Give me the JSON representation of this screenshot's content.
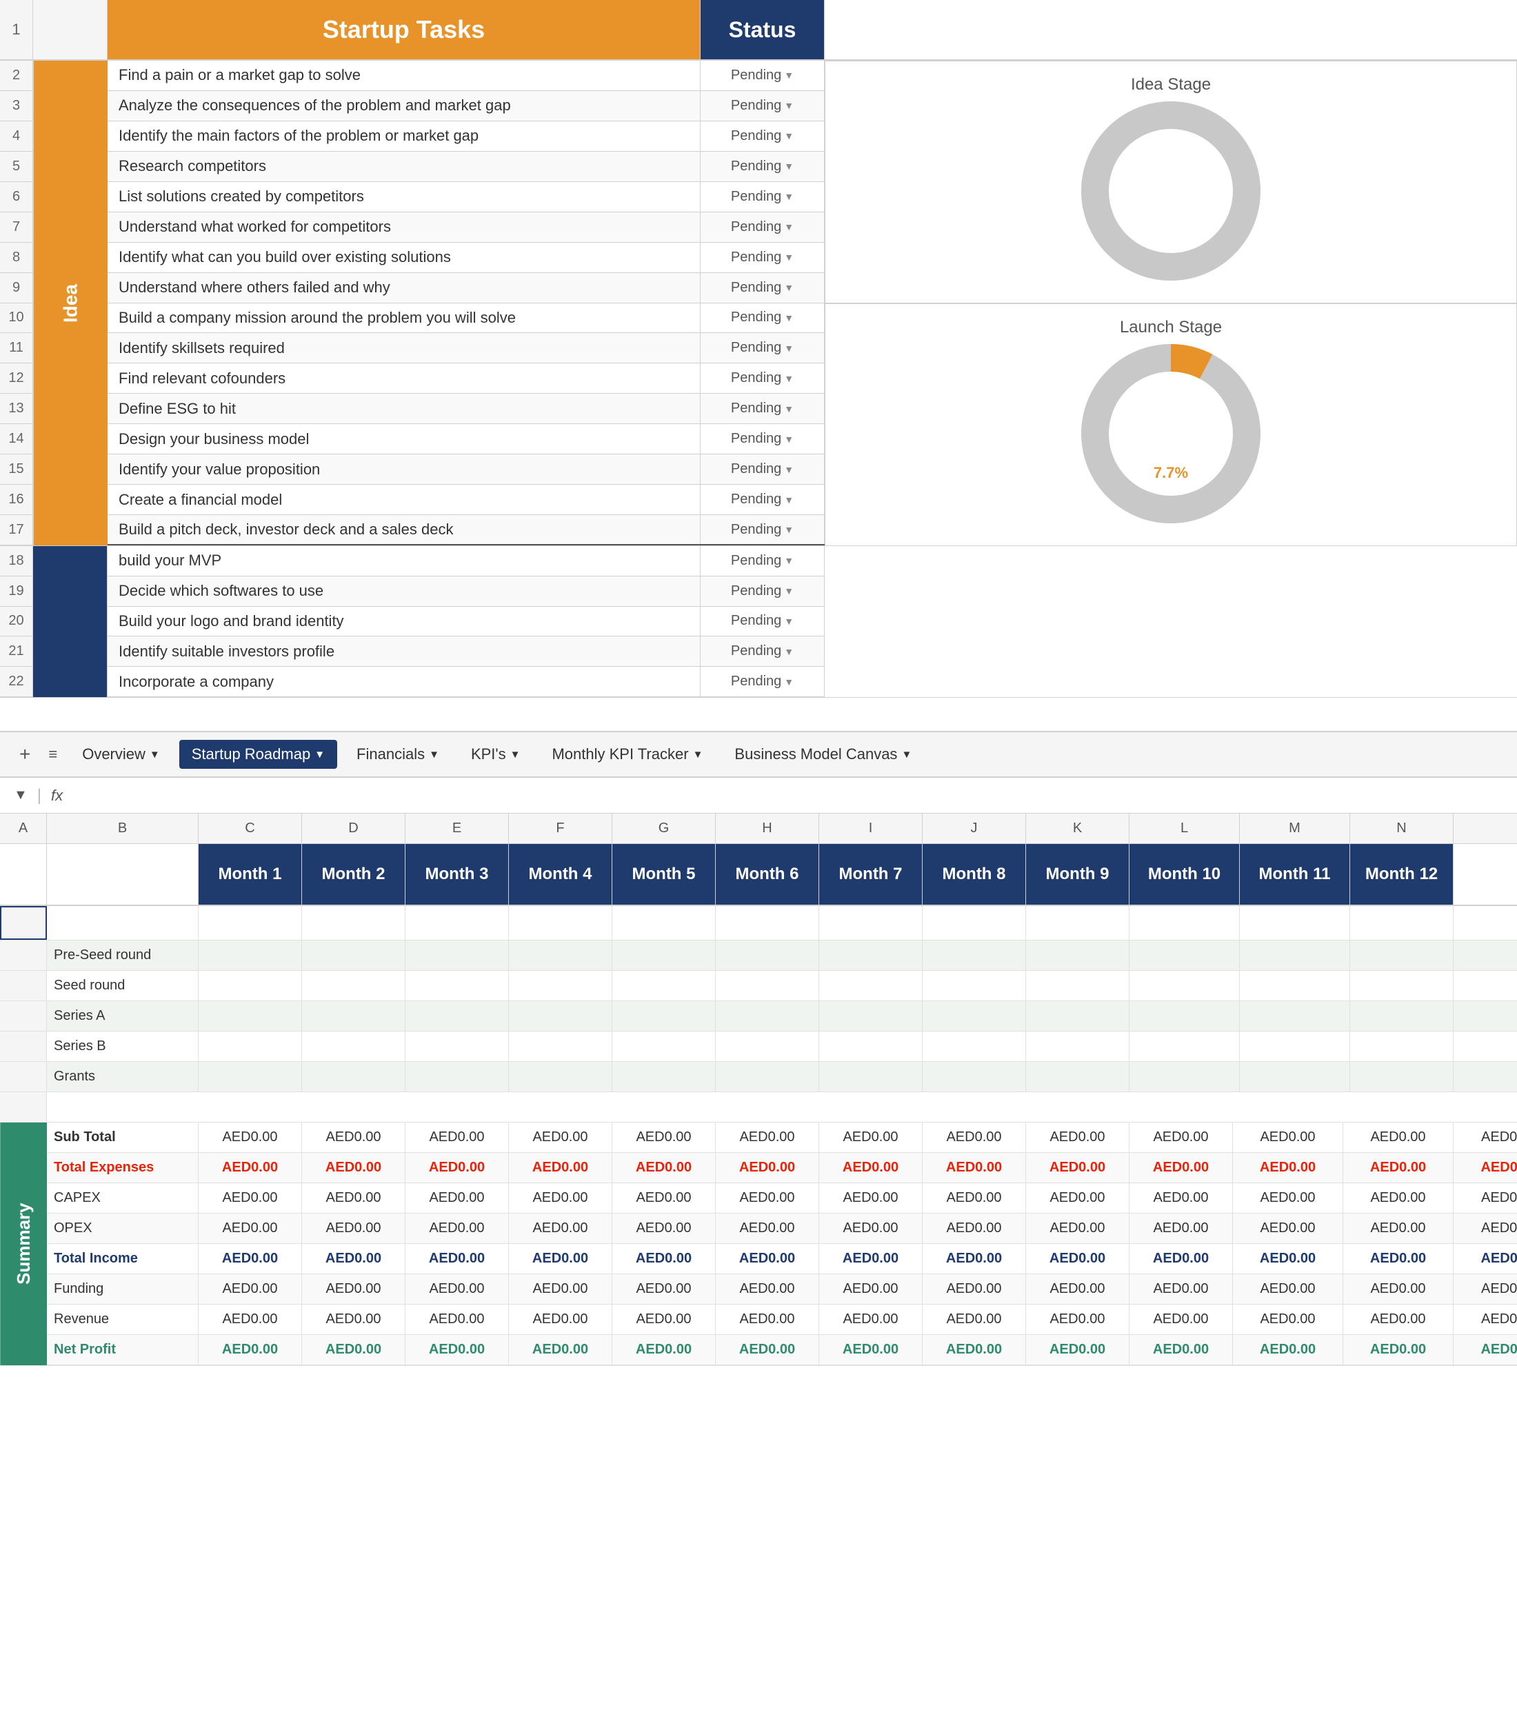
{
  "top": {
    "row1": {
      "num": "1",
      "startup_tasks": "Startup Tasks",
      "status": "Status"
    },
    "tasks": [
      {
        "num": "2",
        "task": "Find a pain or a market gap to solve",
        "status": "Pending"
      },
      {
        "num": "3",
        "task": "Analyze the consequences of the problem and market gap",
        "status": "Pending"
      },
      {
        "num": "4",
        "task": "Identify the main factors of the problem or market gap",
        "status": "Pending"
      },
      {
        "num": "5",
        "task": "Research competitors",
        "status": "Pending"
      },
      {
        "num": "6",
        "task": "List solutions created by competitors",
        "status": "Pending"
      },
      {
        "num": "7",
        "task": "Understand what worked for competitors",
        "status": "Pending"
      },
      {
        "num": "8",
        "task": "Identify what can you build over existing solutions",
        "status": "Pending"
      },
      {
        "num": "9",
        "task": "Understand where others failed and why",
        "status": "Pending"
      },
      {
        "num": "10",
        "task": "Build a company mission around the problem you will solve",
        "status": "Pending"
      },
      {
        "num": "11",
        "task": "Identify skillsets required",
        "status": "Pending"
      },
      {
        "num": "12",
        "task": "Find relevant cofounders",
        "status": "Pending"
      },
      {
        "num": "13",
        "task": "Define ESG to hit",
        "status": "Pending"
      },
      {
        "num": "14",
        "task": "Design your business model",
        "status": "Pending"
      },
      {
        "num": "15",
        "task": "Identify your value proposition",
        "status": "Pending"
      },
      {
        "num": "16",
        "task": "Create a financial model",
        "status": "Pending"
      },
      {
        "num": "17",
        "task": "Build a pitch deck, investor deck and a sales deck",
        "status": "Pending"
      },
      {
        "num": "18",
        "task": "build your MVP",
        "status": "Pending"
      },
      {
        "num": "19",
        "task": "Decide which softwares to use",
        "status": "Pending"
      },
      {
        "num": "20",
        "task": "Build your logo and brand identity",
        "status": "Pending"
      },
      {
        "num": "21",
        "task": "Identify suitable investors profile",
        "status": "Pending"
      },
      {
        "num": "22",
        "task": "Incorporate a company",
        "status": "Pending"
      }
    ],
    "idea_label": "Idea",
    "charts": {
      "idea_stage": "Idea Stage",
      "launch_stage": "Launch Stage",
      "launch_percent": "7.7%"
    }
  },
  "tabs": {
    "items": [
      {
        "label": "Overview",
        "active": false
      },
      {
        "label": "Startup Roadmap",
        "active": true
      },
      {
        "label": "Financials",
        "active": false
      },
      {
        "label": "KPI's",
        "active": false
      },
      {
        "label": "Monthly KPI Tracker",
        "active": false
      },
      {
        "label": "Business Model Canvas",
        "active": false
      }
    ]
  },
  "formula_bar": {
    "content": ""
  },
  "bottom": {
    "col_headers": [
      "A",
      "B",
      "C",
      "D",
      "E",
      "F",
      "G",
      "H",
      "I",
      "J",
      "K",
      "L",
      "M",
      "N"
    ],
    "months": [
      "",
      "",
      "Month 1",
      "Month 2",
      "Month 3",
      "Month 4",
      "Month 5",
      "Month 6",
      "Month 7",
      "Month 8",
      "Month 9",
      "Month 10",
      "Month 11",
      "Month 12"
    ],
    "funding_rows": [
      {
        "label": "Pre-Seed round"
      },
      {
        "label": "Seed round"
      },
      {
        "label": "Series A"
      },
      {
        "label": "Series B"
      },
      {
        "label": "Grants"
      }
    ],
    "summary_rows": [
      {
        "label": "Sub Total",
        "values": [
          "AED0.00",
          "AED0.00",
          "AED0.00",
          "AED0.00",
          "AED0.00",
          "AED0.00",
          "AED0.00",
          "AED0.00",
          "AED0.00",
          "AED0.00",
          "AED0.00",
          "AED0.00"
        ],
        "style": "normal"
      },
      {
        "label": "Total Expenses",
        "values": [
          "AED0.00",
          "AED0.00",
          "AED0.00",
          "AED0.00",
          "AED0.00",
          "AED0.00",
          "AED0.00",
          "AED0.00",
          "AED0.00",
          "AED0.00",
          "AED0.00",
          "AED0.00"
        ],
        "style": "red"
      },
      {
        "label": "CAPEX",
        "values": [
          "AED0.00",
          "AED0.00",
          "AED0.00",
          "AED0.00",
          "AED0.00",
          "AED0.00",
          "AED0.00",
          "AED0.00",
          "AED0.00",
          "AED0.00",
          "AED0.00",
          "AED0.00"
        ],
        "style": "normal"
      },
      {
        "label": "OPEX",
        "values": [
          "AED0.00",
          "AED0.00",
          "AED0.00",
          "AED0.00",
          "AED0.00",
          "AED0.00",
          "AED0.00",
          "AED0.00",
          "AED0.00",
          "AED0.00",
          "AED0.00",
          "AED0.00"
        ],
        "style": "normal"
      },
      {
        "label": "Total Income",
        "values": [
          "AED0.00",
          "AED0.00",
          "AED0.00",
          "AED0.00",
          "AED0.00",
          "AED0.00",
          "AED0.00",
          "AED0.00",
          "AED0.00",
          "AED0.00",
          "AED0.00",
          "AED0.00"
        ],
        "style": "blue"
      },
      {
        "label": "Funding",
        "values": [
          "AED0.00",
          "AED0.00",
          "AED0.00",
          "AED0.00",
          "AED0.00",
          "AED0.00",
          "AED0.00",
          "AED0.00",
          "AED0.00",
          "AED0.00",
          "AED0.00",
          "AED0.00"
        ],
        "style": "normal"
      },
      {
        "label": "Revenue",
        "values": [
          "AED0.00",
          "AED0.00",
          "AED0.00",
          "AED0.00",
          "AED0.00",
          "AED0.00",
          "AED0.00",
          "AED0.00",
          "AED0.00",
          "AED0.00",
          "AED0.00",
          "AED0.00"
        ],
        "style": "normal"
      },
      {
        "label": "Net Profit",
        "values": [
          "AED0.00",
          "AED0.00",
          "AED0.00",
          "AED0.00",
          "AED0.00",
          "AED0.00",
          "AED0.00",
          "AED0.00",
          "AED0.00",
          "AED0.00",
          "AED0.00",
          "AED0.00"
        ],
        "style": "green"
      }
    ],
    "summary_label": "Summary"
  }
}
